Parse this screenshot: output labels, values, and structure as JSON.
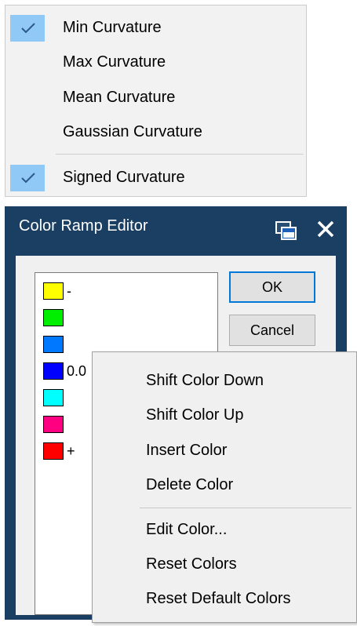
{
  "curvature_menu": {
    "items": [
      {
        "label": "Min Curvature",
        "checked": true
      },
      {
        "label": "Max Curvature",
        "checked": false
      },
      {
        "label": "Mean Curvature",
        "checked": false
      },
      {
        "label": "Gaussian Curvature",
        "checked": false
      },
      {
        "label": "Signed Curvature",
        "checked": true
      }
    ],
    "check_highlight_color": "#90c8f6"
  },
  "dialog": {
    "title": "Color Ramp Editor",
    "title_bar_color": "#1b3f63",
    "icons": [
      "restore-window-icon",
      "close-icon"
    ],
    "ok_label": "OK",
    "cancel_label": "Cancel",
    "ramp": [
      {
        "color": "#ffff00",
        "label": "-"
      },
      {
        "color": "#00ee00",
        "label": ""
      },
      {
        "color": "#0078ff",
        "label": ""
      },
      {
        "color": "#0000ff",
        "label": "0.0"
      },
      {
        "color": "#00ffff",
        "label": ""
      },
      {
        "color": "#ff0080",
        "label": ""
      },
      {
        "color": "#ff0000",
        "label": "+"
      }
    ]
  },
  "context_menu": {
    "items": [
      {
        "label": "Shift Color Down"
      },
      {
        "label": "Shift Color Up"
      },
      {
        "label": "Insert Color"
      },
      {
        "label": "Delete Color"
      },
      {
        "label": "Edit Color..."
      },
      {
        "label": "Reset Colors"
      },
      {
        "label": "Reset Default Colors"
      }
    ]
  }
}
